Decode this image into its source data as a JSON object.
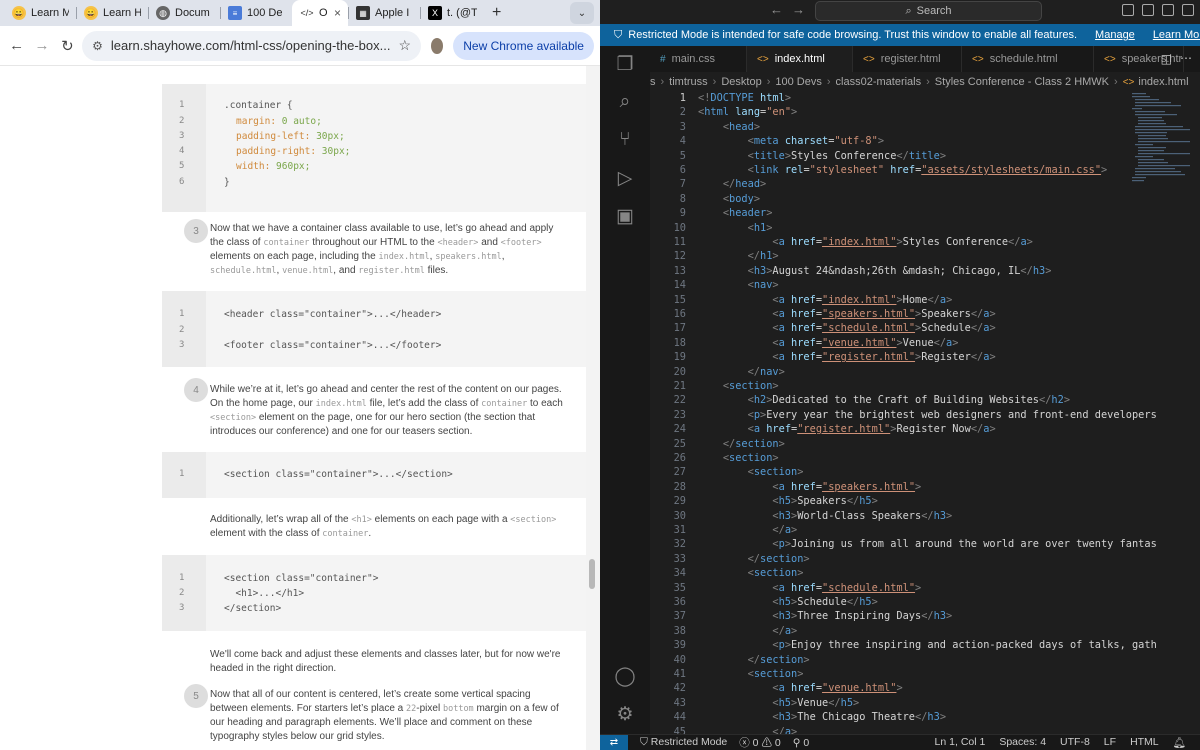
{
  "chrome": {
    "tabs": [
      {
        "title": "Learn M",
        "icon": "grin-icon"
      },
      {
        "title": "Learn H",
        "icon": "grin-icon"
      },
      {
        "title": "Docum",
        "icon": "globe-icon"
      },
      {
        "title": "100 De",
        "icon": "doc-icon"
      },
      {
        "title": "Op",
        "icon": "code-icon",
        "active": true,
        "close": "×"
      },
      {
        "title": "Apple I",
        "icon": "apple-news-icon"
      },
      {
        "title": "t. (@Tir",
        "icon": "x-logo-icon"
      }
    ],
    "new_tab": "+",
    "tab_menu": "⌄",
    "url": "learn.shayhowe.com/html-css/opening-the-box...",
    "new_chrome": "New Chrome available",
    "page": {
      "code1": [
        {
          "n": "1",
          "text": ".container {"
        },
        {
          "n": "2",
          "prop": "margin:",
          "val": " 0 auto;"
        },
        {
          "n": "3",
          "prop": "padding-left:",
          "val": " 30px;"
        },
        {
          "n": "4",
          "prop": "padding-right:",
          "val": " 30px;"
        },
        {
          "n": "5",
          "prop": "width:",
          "val": " 960px;"
        },
        {
          "n": "6",
          "text": "}"
        }
      ],
      "step3": {
        "num": "3"
      },
      "code2": [
        {
          "n": "1",
          "text": "<header class=\"container\">...</header>"
        },
        {
          "n": "2",
          "text": ""
        },
        {
          "n": "3",
          "text": "<footer class=\"container\">...</footer>"
        }
      ],
      "step4": {
        "num": "4"
      },
      "code3": [
        {
          "n": "1",
          "text": "<section class=\"container\">...</section>"
        }
      ],
      "para_additionally": "",
      "code4": [
        {
          "n": "1",
          "text": "<section class=\"container\">"
        },
        {
          "n": "2",
          "text": "  <h1>...</h1>"
        },
        {
          "n": "3",
          "text": "</section>"
        }
      ],
      "para_comeback": "We'll come back and adjust these elements and classes later, but for now we're headed in the right direction.",
      "step5": {
        "num": "5"
      }
    }
  },
  "vscode": {
    "search": "Search",
    "restricted": {
      "message": "Restricted Mode is intended for safe code browsing. Trust this window to enable all features.",
      "manage": "Manage",
      "learn_more": "Learn More"
    },
    "tabs": [
      {
        "name": "main.css",
        "icon": "#",
        "kind": "css"
      },
      {
        "name": "index.html",
        "icon": "<>",
        "kind": "html",
        "active": true
      },
      {
        "name": "register.html",
        "icon": "<>",
        "kind": "html"
      },
      {
        "name": "schedule.html",
        "icon": "<>",
        "kind": "html"
      },
      {
        "name": "speakers.htr",
        "icon": "<>",
        "kind": "html"
      }
    ],
    "breadcrumbs": [
      "s",
      "timtruss",
      "Desktop",
      "100 Devs",
      "class02-materials",
      "Styles Conference - Class 2 HMWK",
      "index.html"
    ],
    "status": {
      "restricted": "Restricted Mode",
      "errors": "0",
      "warnings": "0",
      "ports": "0",
      "position": "Ln 1, Col 1",
      "spaces": "Spaces: 4",
      "encoding": "UTF-8",
      "eol": "LF",
      "language": "HTML"
    }
  }
}
